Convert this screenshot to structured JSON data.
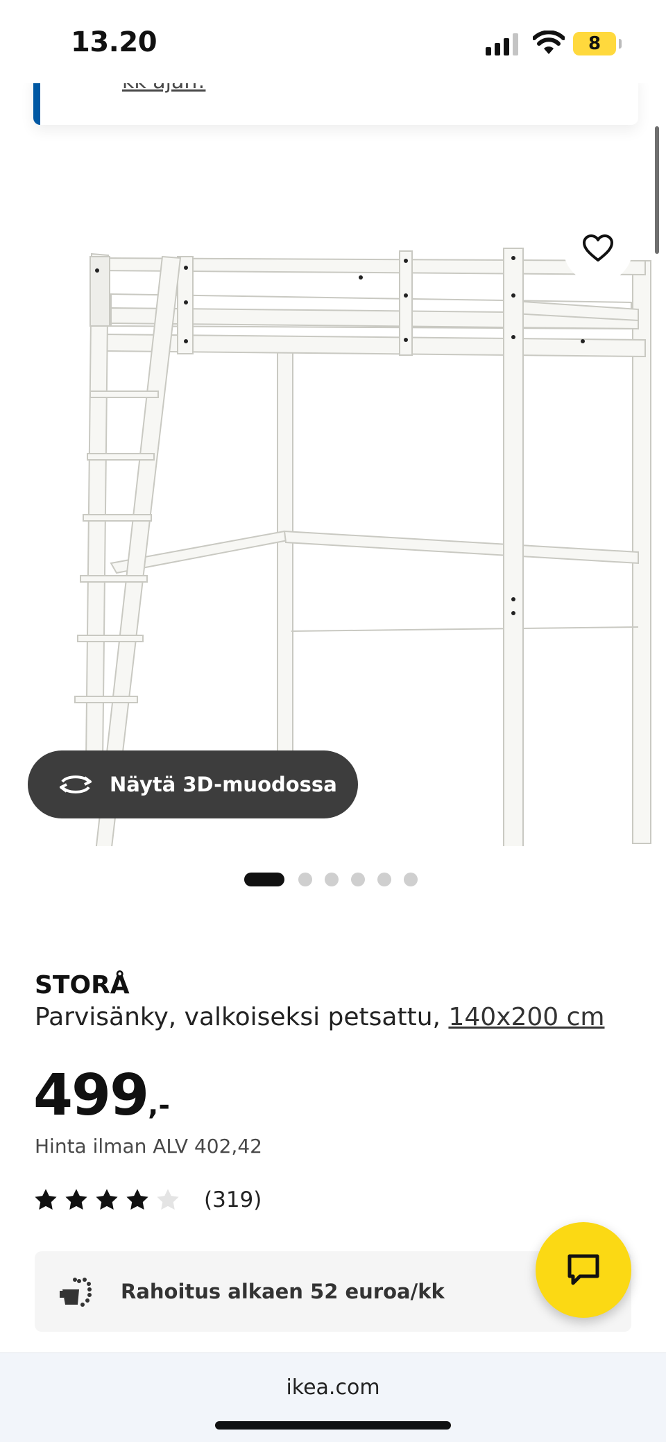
{
  "status_bar": {
    "time": "13.20",
    "battery": "8"
  },
  "notice": {
    "link_text": "kk ajan!"
  },
  "gallery": {
    "view_3d_label": "Näytä 3D-muodossa",
    "slide_count": 6,
    "active_slide": 1
  },
  "product": {
    "name": "STORÅ",
    "description": "Parvisänky, valkoiseksi petsattu, ",
    "size": "140x200 cm",
    "price": "499",
    "price_suffix": ",-",
    "vat_text": "Hinta ilman ALV 402,42",
    "rating": 4,
    "rating_max": 5,
    "review_count": "(319)"
  },
  "financing": {
    "label": "Rahoitus alkaen 52 euroa/kk"
  },
  "browser": {
    "url": "ikea.com"
  },
  "colors": {
    "accent_blue": "#0058a3",
    "chat_yellow": "#fbd914",
    "view3d_bg": "#3d3d3d"
  }
}
